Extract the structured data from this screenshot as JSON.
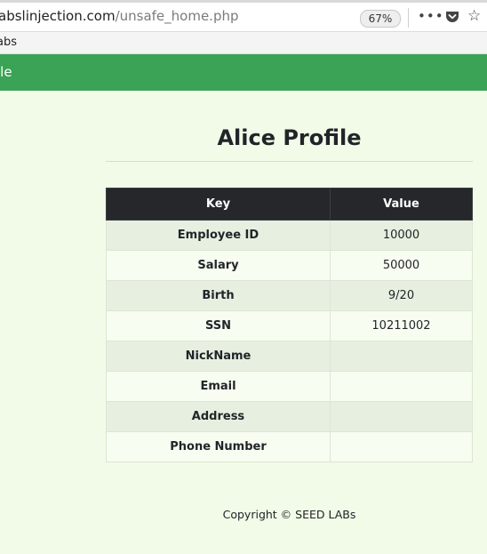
{
  "browser": {
    "url_host": "abslinjection.com",
    "url_path": "/unsafe_home.php",
    "zoom": "67%",
    "more_icon": "•••",
    "star_icon": "☆",
    "bookmark_label": "abs"
  },
  "navbar": {
    "brand": "ile"
  },
  "page": {
    "title": "Alice Profile",
    "table": {
      "headers": [
        "Key",
        "Value"
      ],
      "rows": [
        {
          "key": "Employee ID",
          "value": "10000"
        },
        {
          "key": "Salary",
          "value": "50000"
        },
        {
          "key": "Birth",
          "value": "9/20"
        },
        {
          "key": "SSN",
          "value": "10211002"
        },
        {
          "key": "NickName",
          "value": ""
        },
        {
          "key": "Email",
          "value": ""
        },
        {
          "key": "Address",
          "value": ""
        },
        {
          "key": "Phone Number",
          "value": ""
        }
      ]
    },
    "footer": "Copyright © SEED LABs"
  },
  "colors": {
    "navbar": "#3ba356",
    "page_bg": "#f1fbe7",
    "table_header": "#25272b"
  }
}
